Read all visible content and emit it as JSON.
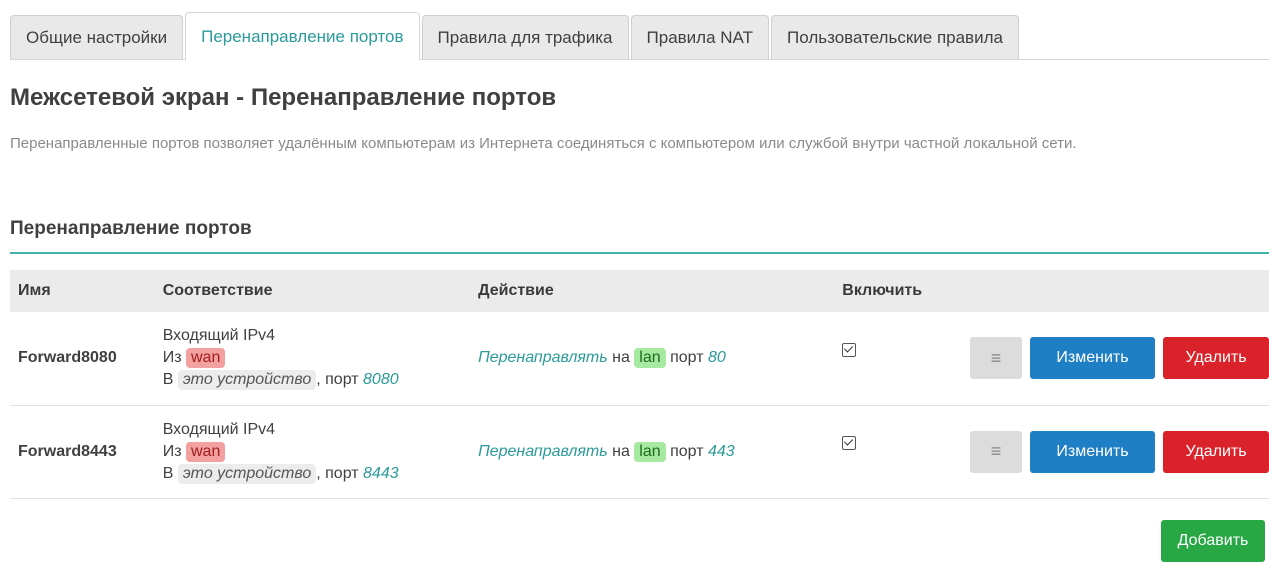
{
  "tabs": [
    {
      "label": "Общие настройки",
      "active": false
    },
    {
      "label": "Перенаправление портов",
      "active": true
    },
    {
      "label": "Правила для трафика",
      "active": false
    },
    {
      "label": "Правила NAT",
      "active": false
    },
    {
      "label": "Пользовательские правила",
      "active": false
    }
  ],
  "page": {
    "title": "Межсетевой экран - Перенаправление портов",
    "description": "Перенаправленные портов позволяет удалённым компьютерам из Интернета соединяться с компьютером или службой внутри частной локальной сети."
  },
  "section": {
    "title": "Перенаправление портов"
  },
  "table": {
    "headers": {
      "name": "Имя",
      "match": "Соответствие",
      "action": "Действие",
      "enable": "Включить"
    },
    "rows": [
      {
        "name": "Forward8080",
        "match_line1": "Входящий IPv4",
        "from_prefix": "Из",
        "from_zone": "wan",
        "to_prefix": "В",
        "to_target": "это устройство",
        "port_prefix": ", порт",
        "match_port": "8080",
        "action_verb": "Перенаправлять",
        "action_on": "на",
        "action_zone": "lan",
        "action_port_label": "порт",
        "action_port": "80",
        "enabled": true
      },
      {
        "name": "Forward8443",
        "match_line1": "Входящий IPv4",
        "from_prefix": "Из",
        "from_zone": "wan",
        "to_prefix": "В",
        "to_target": "это устройство",
        "port_prefix": ", порт",
        "match_port": "8443",
        "action_verb": "Перенаправлять",
        "action_on": "на",
        "action_zone": "lan",
        "action_port_label": "порт",
        "action_port": "443",
        "enabled": true
      }
    ]
  },
  "buttons": {
    "drag_icon": "≡",
    "edit": "Изменить",
    "delete": "Удалить",
    "add": "Добавить"
  },
  "colors": {
    "accent": "#2b9a9a",
    "edit": "#1f7fc4",
    "delete": "#d9222a",
    "add": "#28a745",
    "wan": "#f2a0a0",
    "lan": "#a6e9a0"
  }
}
